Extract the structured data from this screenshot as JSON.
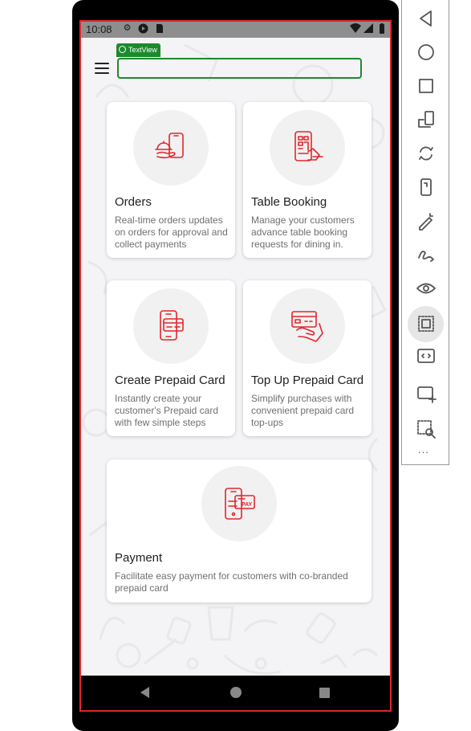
{
  "status_bar": {
    "time": "10:08"
  },
  "toolbar": {
    "debug_tag": "TextView"
  },
  "cards": [
    {
      "id": "orders",
      "title": "Orders",
      "description": "Real-time orders updates on orders for approval and collect payments",
      "icon": "food-tray-phone-icon"
    },
    {
      "id": "table-booking",
      "title": "Table Booking",
      "description": "Manage your customers advance table booking requests for dining in.",
      "icon": "phone-table-map-icon"
    },
    {
      "id": "create-prepaid-card",
      "title": "Create Prepaid Card",
      "description": "Instantly create your customer's Prepaid card with few simple steps",
      "icon": "phone-card-icon"
    },
    {
      "id": "top-up-prepaid-card",
      "title": "Top Up Prepaid Card",
      "description": "Simplify purchases with convenient prepaid card top-ups",
      "icon": "hand-card-icon"
    },
    {
      "id": "payment",
      "title": "Payment",
      "description": "Facilitate easy payment for customers with co-branded prepaid card",
      "icon": "phone-pay-icon",
      "icon_label": "PAY"
    }
  ],
  "colors": {
    "accent": "#e3262d",
    "debug_green": "#1c8a2c",
    "outline_red": "#e0242c"
  },
  "emulator_toolbar": [
    "back-icon",
    "home-icon",
    "overview-icon",
    "rotate-left-icon",
    "rotate-right-icon",
    "fold-icon",
    "pen-icon",
    "draw-icon",
    "eye-icon",
    "layout-bounds-icon",
    "screenshot-area-icon",
    "add-device-icon",
    "zoom-select-icon",
    "more-icon"
  ],
  "more_label": "..."
}
